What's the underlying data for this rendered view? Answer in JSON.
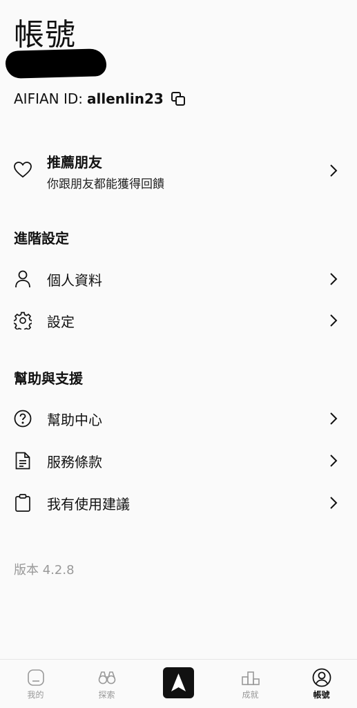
{
  "header": {
    "title": "帳號"
  },
  "account": {
    "id_label": "AIFIAN ID:",
    "id_value": "allenlin23"
  },
  "referral": {
    "title": "推薦朋友",
    "subtitle": "你跟朋友都能獲得回饋"
  },
  "advanced": {
    "heading": "進階設定",
    "items": [
      {
        "label": "個人資料",
        "icon": "person-icon"
      },
      {
        "label": "設定",
        "icon": "gear-icon"
      }
    ]
  },
  "help": {
    "heading": "幫助與支援",
    "items": [
      {
        "label": "幫助中心",
        "icon": "question-circle-icon"
      },
      {
        "label": "服務條款",
        "icon": "document-icon"
      },
      {
        "label": "我有使用建議",
        "icon": "clipboard-icon"
      }
    ]
  },
  "version": "版本 4.2.8",
  "tabbar": {
    "tabs": [
      {
        "label": "我的",
        "icon": "home-box-icon"
      },
      {
        "label": "探索",
        "icon": "binoculars-icon"
      },
      {
        "label": "",
        "icon": "aifian-logo-icon"
      },
      {
        "label": "成就",
        "icon": "podium-icon"
      },
      {
        "label": "帳號",
        "icon": "account-circle-icon"
      }
    ],
    "active": "帳號"
  }
}
